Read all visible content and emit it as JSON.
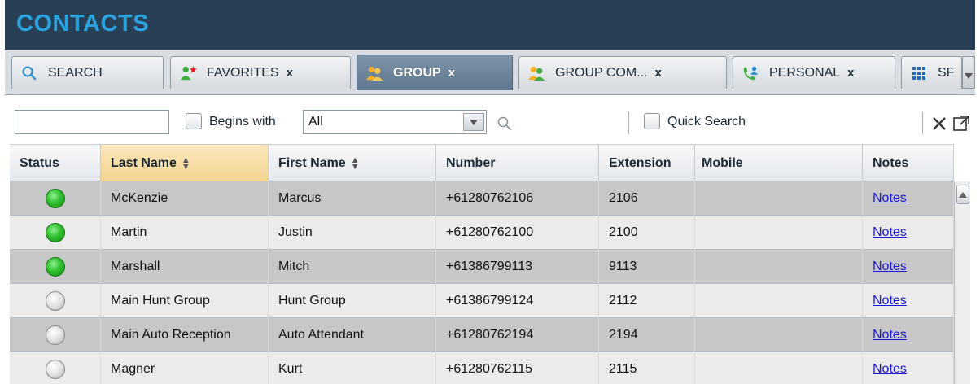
{
  "app": {
    "title": "CONTACTS"
  },
  "tabs": [
    {
      "label": "SEARCH",
      "icon": "search-icon",
      "closable": false,
      "active": false
    },
    {
      "label": "FAVORITES",
      "icon": "favorites-icon",
      "closable": true,
      "active": false
    },
    {
      "label": "GROUP",
      "icon": "group-icon",
      "closable": true,
      "active": true
    },
    {
      "label": "GROUP COM...",
      "icon": "group-common-icon",
      "closable": true,
      "active": false
    },
    {
      "label": "PERSONAL",
      "icon": "personal-icon",
      "closable": true,
      "active": false
    },
    {
      "label": "SF",
      "icon": "speed-dial-icon",
      "closable": false,
      "active": false
    }
  ],
  "tab_close_label": "x",
  "search": {
    "input_value": "",
    "begins_with_label": "Begins with",
    "begins_with_checked": false,
    "filter_selected": "All",
    "quick_search_label": "Quick Search",
    "quick_search_checked": false
  },
  "columns": {
    "status": "Status",
    "last_name": "Last Name",
    "first_name": "First Name",
    "number": "Number",
    "extension": "Extension",
    "mobile": "Mobile",
    "notes": "Notes"
  },
  "rows": [
    {
      "status": "available",
      "last_name": "McKenzie",
      "first_name": "Marcus",
      "number": "+61280762106",
      "extension": "2106",
      "mobile": "",
      "notes": "Notes"
    },
    {
      "status": "available",
      "last_name": "Martin",
      "first_name": "Justin",
      "number": "+61280762100",
      "extension": "2100",
      "mobile": "",
      "notes": "Notes"
    },
    {
      "status": "available",
      "last_name": "Marshall",
      "first_name": "Mitch",
      "number": "+61386799113",
      "extension": "9113",
      "mobile": "",
      "notes": "Notes"
    },
    {
      "status": "unknown",
      "last_name": "Main Hunt Group",
      "first_name": "Hunt Group",
      "number": "+61386799124",
      "extension": "2112",
      "mobile": "",
      "notes": "Notes"
    },
    {
      "status": "unknown",
      "last_name": "Main Auto Reception",
      "first_name": "Auto Attendant",
      "number": "+61280762194",
      "extension": "2194",
      "mobile": "",
      "notes": "Notes"
    },
    {
      "status": "unknown",
      "last_name": "Magner",
      "first_name": "Kurt",
      "number": "+61280762115",
      "extension": "2115",
      "mobile": "",
      "notes": "Notes"
    }
  ],
  "colors": {
    "title_bar": "#283f55",
    "title_text": "#2aa3dc",
    "status_available": "#30c030",
    "status_unknown": "#e2e2e2",
    "link": "#1a17d6",
    "sorted_header": "#f4d48d"
  }
}
